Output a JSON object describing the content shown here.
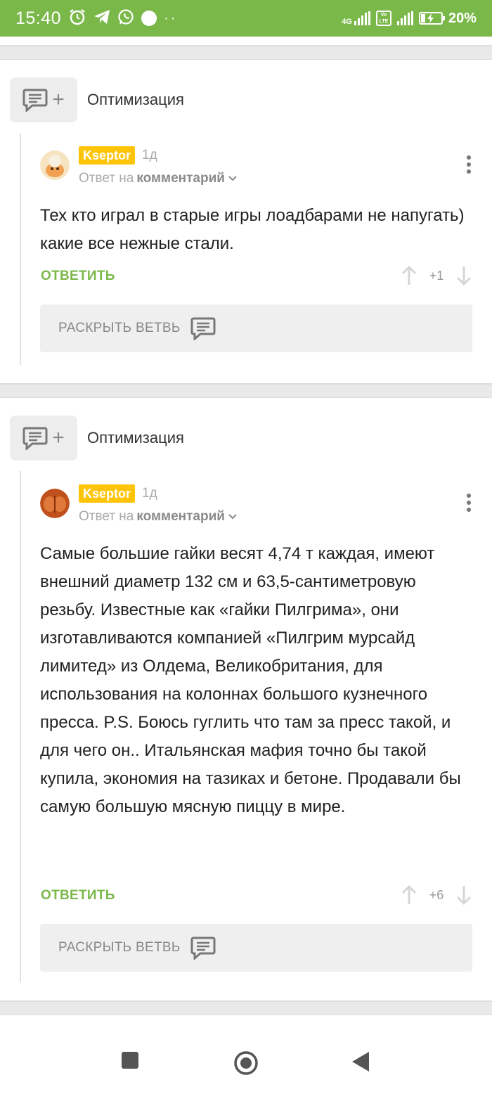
{
  "status_bar": {
    "time": "15:40",
    "network_label": "4G",
    "volte_label": "Vo LTE",
    "battery": "20%",
    "battery_level": 0.2,
    "icons": [
      "alarm-icon",
      "telegram-icon",
      "whatsapp-icon",
      "notification-dot-icon",
      "more-dots-icon",
      "signal-icon",
      "volte-icon",
      "signal-icon",
      "battery-icon"
    ]
  },
  "threads": [
    {
      "topic": "Оптимизация",
      "comment": {
        "user": "Kseptor",
        "time": "1д",
        "reply_prefix": "Ответ на",
        "reply_target": "комментарий",
        "text": "Тех кто играл в старые игры лоадбарами не напугать) какие все нежные стали.",
        "reply_label": "ОТВЕТИТЬ",
        "rating": "+1",
        "expand_label": "РАСКРЫТЬ ВЕТВЬ"
      }
    },
    {
      "topic": "Оптимизация",
      "comment": {
        "user": "Kseptor",
        "time": "1д",
        "reply_prefix": "Ответ на",
        "reply_target": "комментарий",
        "text": "Самые большие гайки весят 4,74 т каждая, имеют внешний диаметр 132 см и 63,5-сантиметровую резьбу. Известные как «гайки Пилгрима», они изготавливаются компанией «Пилгрим мурсайд лимитед» из Олдема, Великобритания, для использования на колоннах большого кузнечного пресса. P.S. Боюсь гуглить что там за пресс такой, и для чего он.. Итальянская мафия точно бы такой купила, экономия на тазиках и бетоне. Продавали бы самую большую мясную пиццу в мире.",
        "reply_label": "ОТВЕТИТЬ",
        "rating": "+6",
        "expand_label": "РАСКРЫТЬ ВЕТВЬ"
      }
    }
  ],
  "nav_bar": {
    "buttons": [
      "recents-square-icon",
      "home-circle-icon",
      "back-triangle-icon"
    ]
  },
  "colors": {
    "accent_green": "#7bb84a",
    "user_badge": "#fdc408"
  }
}
